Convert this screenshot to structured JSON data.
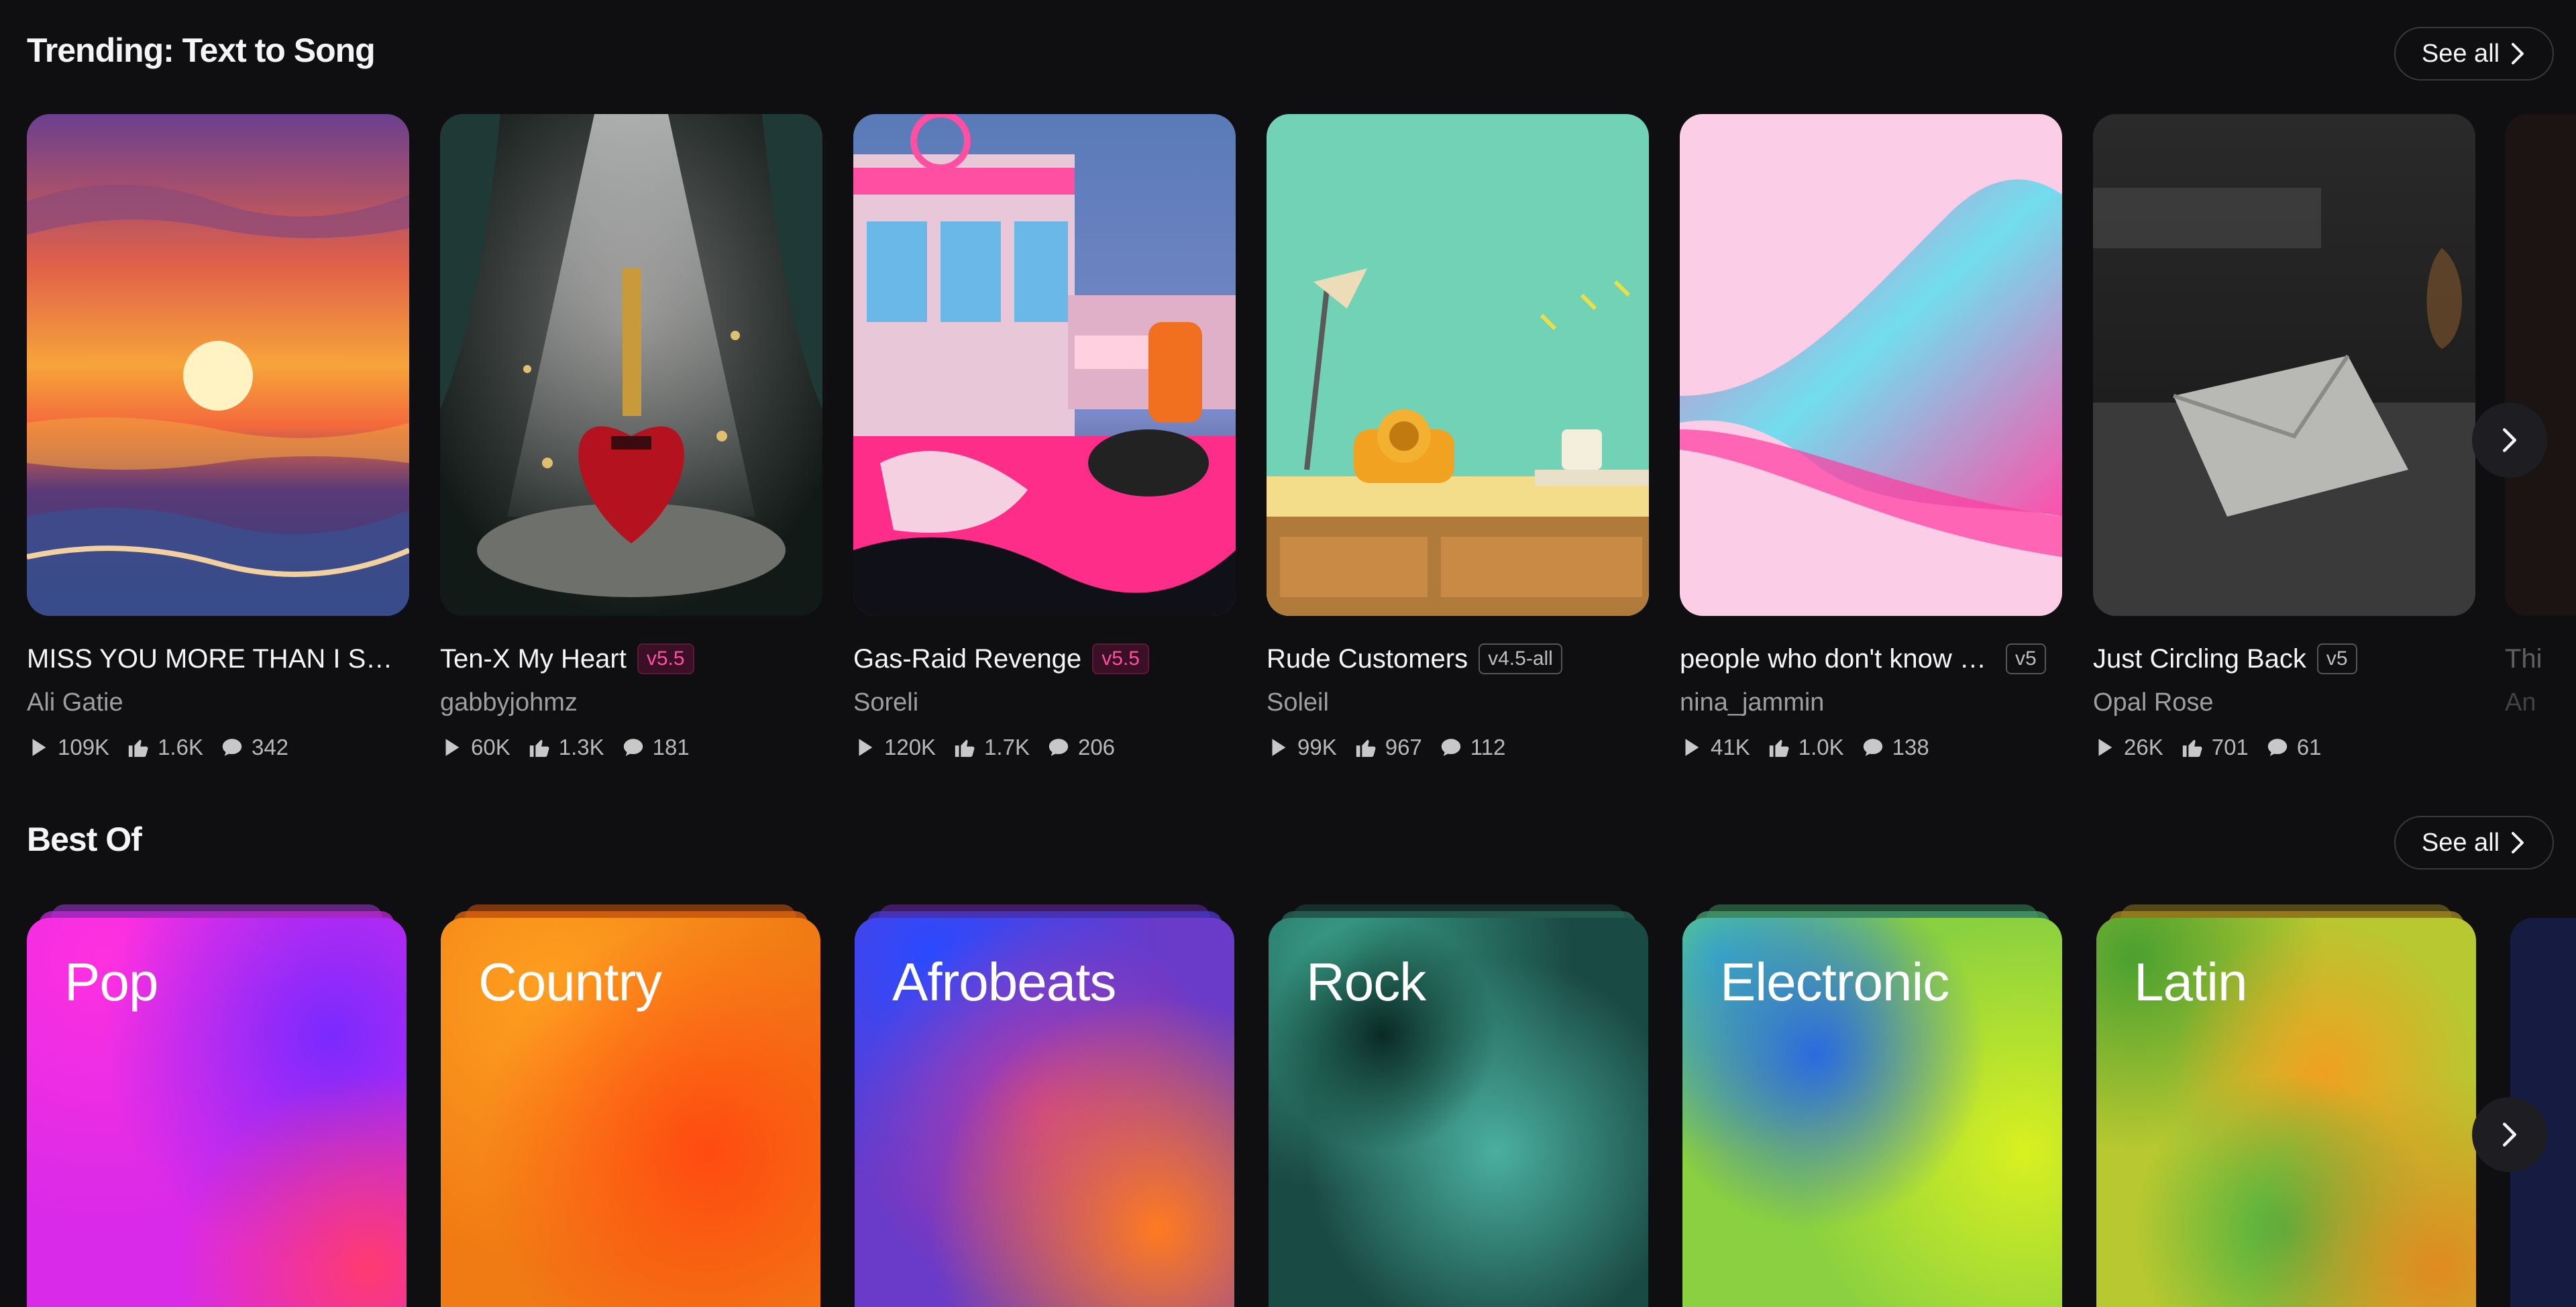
{
  "trending": {
    "title": "Trending: Text to Song",
    "see_all": "See all",
    "cards": [
      {
        "title": "MISS YOU MORE THAN I SHO...",
        "badge": "",
        "artist": "Ali Gatie",
        "plays": "109K",
        "likes": "1.6K",
        "comments": "342"
      },
      {
        "title": "Ten-X My Heart",
        "badge": "v5.5",
        "artist": "gabbyjohmz",
        "plays": "60K",
        "likes": "1.3K",
        "comments": "181"
      },
      {
        "title": "Gas-Raid Revenge",
        "badge": "v5.5",
        "artist": "Soreli",
        "plays": "120K",
        "likes": "1.7K",
        "comments": "206"
      },
      {
        "title": "Rude Customers",
        "badge": "v4.5-all",
        "artist": "Soleil",
        "plays": "99K",
        "likes": "967",
        "comments": "112"
      },
      {
        "title": "people who don't know ho...",
        "badge": "v5",
        "artist": "nina_jammin",
        "plays": "41K",
        "likes": "1.0K",
        "comments": "138"
      },
      {
        "title": "Just Circling Back",
        "badge": "v5",
        "artist": "Opal Rose",
        "plays": "26K",
        "likes": "701",
        "comments": "61"
      }
    ],
    "peek": {
      "title": "Thi",
      "artist": "An"
    }
  },
  "best_of": {
    "title": "Best Of",
    "see_all": "See all",
    "genres": [
      "Pop",
      "Country",
      "Afrobeats",
      "Rock",
      "Electronic",
      "Latin"
    ]
  },
  "icons": {
    "play": "play-icon",
    "like": "thumbs-up-icon",
    "comment": "comment-icon",
    "chevron": "chevron-right-icon"
  },
  "colors": {
    "background": "#0f0f12",
    "badge_pink": "#ff4fa3",
    "muted_text": "#9e9e9e"
  }
}
